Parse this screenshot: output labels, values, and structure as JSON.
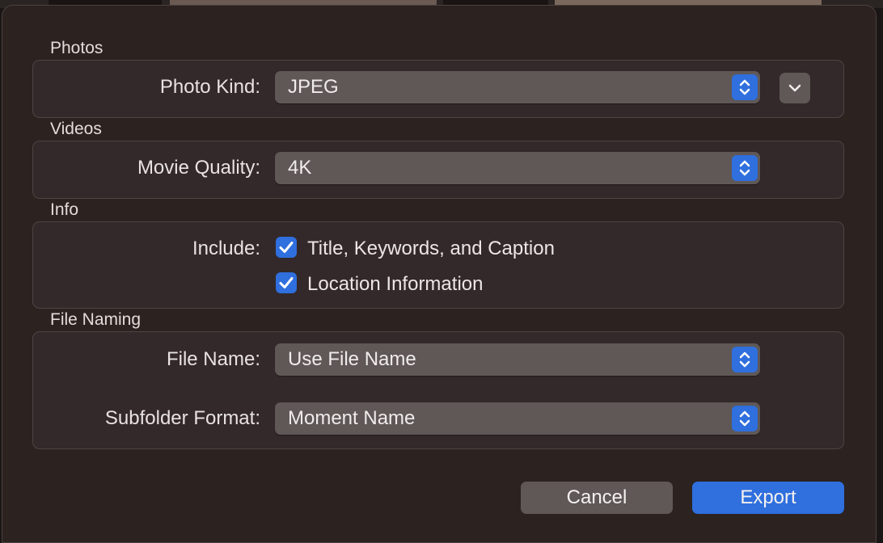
{
  "sections": {
    "photos": {
      "title": "Photos",
      "photo_kind_label": "Photo Kind:",
      "photo_kind_value": "JPEG"
    },
    "videos": {
      "title": "Videos",
      "movie_quality_label": "Movie Quality:",
      "movie_quality_value": "4K"
    },
    "info": {
      "title": "Info",
      "include_label": "Include:",
      "options": [
        {
          "label": "Title, Keywords, and Caption",
          "checked": true
        },
        {
          "label": "Location Information",
          "checked": true
        }
      ]
    },
    "file_naming": {
      "title": "File Naming",
      "file_name_label": "File Name:",
      "file_name_value": "Use File Name",
      "subfolder_label": "Subfolder Format:",
      "subfolder_value": "Moment Name"
    }
  },
  "buttons": {
    "cancel": "Cancel",
    "export": "Export"
  },
  "icons": {
    "popup_stepper": "chevron-up-down-icon",
    "expand": "chevron-down-icon",
    "checkbox": "checkmark-icon"
  },
  "colors": {
    "accent": "#2f6fde",
    "dialog_bg": "#2c2220",
    "control_bg": "#5f5857"
  }
}
